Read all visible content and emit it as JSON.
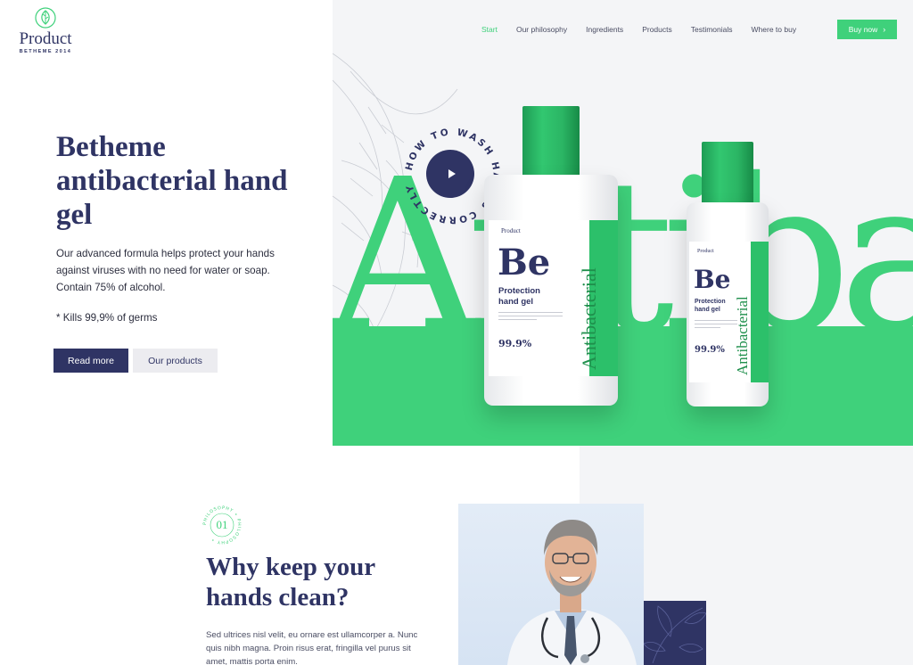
{
  "brand": {
    "name": "Product",
    "tagline": "BETHEME 2014"
  },
  "nav": {
    "items": [
      "Start",
      "Our philosophy",
      "Ingredients",
      "Products",
      "Testimonials",
      "Where to buy"
    ],
    "active": "Start",
    "cta": "Buy now"
  },
  "hero": {
    "title": "Betheme antibacterial hand gel",
    "description": "Our advanced formula helps protect your hands against viruses with no need for water or soap. Contain 75% of alcohol.",
    "note": "* Kills 99,9% of germs",
    "primary_button": "Read more",
    "secondary_button": "Our products",
    "background_word": "Antibact",
    "video_caption": "HOW TO WASH HANDS CORRECTLY"
  },
  "bottle_label": {
    "brand": "Product",
    "mark": "Be",
    "name_line1": "Protection",
    "name_line2": "hand gel",
    "percent": "99.9%",
    "stripe_word": "Antibacterial"
  },
  "section2": {
    "badge_number": "01",
    "badge_ring_text": "PHILOSOPHY • PHILOSOPHY •",
    "title": "Why keep your hands clean?",
    "text": "Sed ultrices nisl velit, eu ornare est ullamcorper a. Nunc quis nibh magna. Proin risus erat, fringilla vel purus sit amet, mattis porta enim."
  },
  "colors": {
    "accent": "#3fd17b",
    "navy": "#2f3464",
    "light": "#f4f5f7"
  },
  "icons": [
    "leaf-logo-icon",
    "chevron-right-icon",
    "play-icon"
  ]
}
